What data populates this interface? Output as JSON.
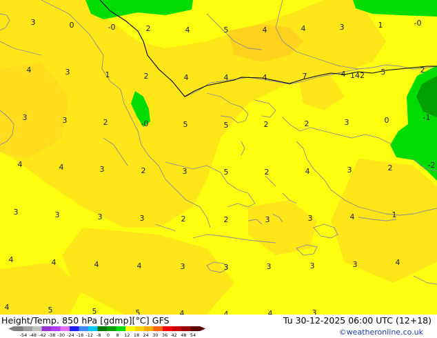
{
  "title": "Height/Temp. 850 hPa [gdmp][°C] GFS",
  "valid_time": "Tu 30-12-2025 06:00 UTC (12+18)",
  "credit": "©weatheronline.co.uk",
  "contour_label": "142",
  "temperature_labels": [
    {
      "text": "3"
    },
    {
      "text": "0"
    },
    {
      "text": "-0"
    },
    {
      "text": "2"
    },
    {
      "text": "4"
    },
    {
      "text": "5"
    },
    {
      "text": "4"
    },
    {
      "text": "4"
    },
    {
      "text": "3"
    },
    {
      "text": "1"
    },
    {
      "text": "-0"
    },
    {
      "text": "4"
    },
    {
      "text": "3"
    },
    {
      "text": "1"
    },
    {
      "text": "2"
    },
    {
      "text": "4"
    },
    {
      "text": "4"
    },
    {
      "text": "4"
    },
    {
      "text": "7"
    },
    {
      "text": "4"
    },
    {
      "text": "5"
    },
    {
      "text": "2"
    },
    {
      "text": "3"
    },
    {
      "text": "3"
    },
    {
      "text": "2"
    },
    {
      "text": "-0"
    },
    {
      "text": "5"
    },
    {
      "text": "5"
    },
    {
      "text": "2"
    },
    {
      "text": "2"
    },
    {
      "text": "3"
    },
    {
      "text": "0"
    },
    {
      "text": "-1"
    },
    {
      "text": "4"
    },
    {
      "text": "4"
    },
    {
      "text": "3"
    },
    {
      "text": "2"
    },
    {
      "text": "3"
    },
    {
      "text": "5"
    },
    {
      "text": "2"
    },
    {
      "text": "4"
    },
    {
      "text": "3"
    },
    {
      "text": "2"
    },
    {
      "text": "-2"
    },
    {
      "text": "3"
    },
    {
      "text": "3"
    },
    {
      "text": "3"
    },
    {
      "text": "3"
    },
    {
      "text": "2"
    },
    {
      "text": "2"
    },
    {
      "text": "3"
    },
    {
      "text": "3"
    },
    {
      "text": "4"
    },
    {
      "text": "1"
    },
    {
      "text": "4"
    },
    {
      "text": "4"
    },
    {
      "text": "4"
    },
    {
      "text": "4"
    },
    {
      "text": "3"
    },
    {
      "text": "3"
    },
    {
      "text": "3"
    },
    {
      "text": "3"
    },
    {
      "text": "3"
    },
    {
      "text": "4"
    },
    {
      "text": "4"
    },
    {
      "text": "5"
    },
    {
      "text": "5"
    },
    {
      "text": "5"
    },
    {
      "text": "4"
    },
    {
      "text": "4"
    },
    {
      "text": "4"
    },
    {
      "text": "3"
    }
  ],
  "legend": {
    "ticks": [
      "-54",
      "-48",
      "-42",
      "-38",
      "-30",
      "-24",
      "-18",
      "-12",
      "-8",
      "0",
      "8",
      "12",
      "18",
      "24",
      "30",
      "36",
      "42",
      "48",
      "54"
    ],
    "colors": [
      "#808080",
      "#a0a0a0",
      "#c0c0c0",
      "#9a32cd",
      "#b03cff",
      "#e070ff",
      "#2020ff",
      "#3c8cff",
      "#00c8ff",
      "#007800",
      "#00a000",
      "#00dc00",
      "#ffff00",
      "#ffd200",
      "#ffaa00",
      "#ff6400",
      "#ff0000",
      "#c80000",
      "#960000",
      "#5a0000"
    ]
  },
  "colors": {
    "warm_yellow": "#ffff00",
    "gold": "#ffdc1e",
    "green": "#00dc00",
    "dark_green": "#00a000",
    "coast": "#8c8c8c",
    "contour": "#000000",
    "credit": "#1f3aa8"
  }
}
